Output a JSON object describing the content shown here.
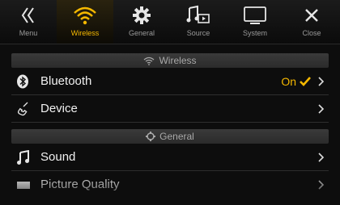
{
  "tabs": [
    {
      "label": "Menu",
      "icon": "double-chevron-left-icon"
    },
    {
      "label": "Wireless",
      "icon": "wifi-icon",
      "active": true
    },
    {
      "label": "General",
      "icon": "gear-icon"
    },
    {
      "label": "Source",
      "icon": "music-source-icon"
    },
    {
      "label": "System",
      "icon": "monitor-icon"
    },
    {
      "label": "Close",
      "icon": "close-icon"
    }
  ],
  "sections": {
    "wireless": "Wireless",
    "general": "General"
  },
  "rows": {
    "bluetooth": {
      "label": "Bluetooth",
      "value": "On"
    },
    "device": {
      "label": "Device"
    },
    "sound": {
      "label": "Sound"
    },
    "picture_quality": {
      "label": "Picture Quality"
    }
  },
  "colors": {
    "accent": "#f5b800",
    "background": "#0d0d0d",
    "section_bar": "#333333"
  }
}
